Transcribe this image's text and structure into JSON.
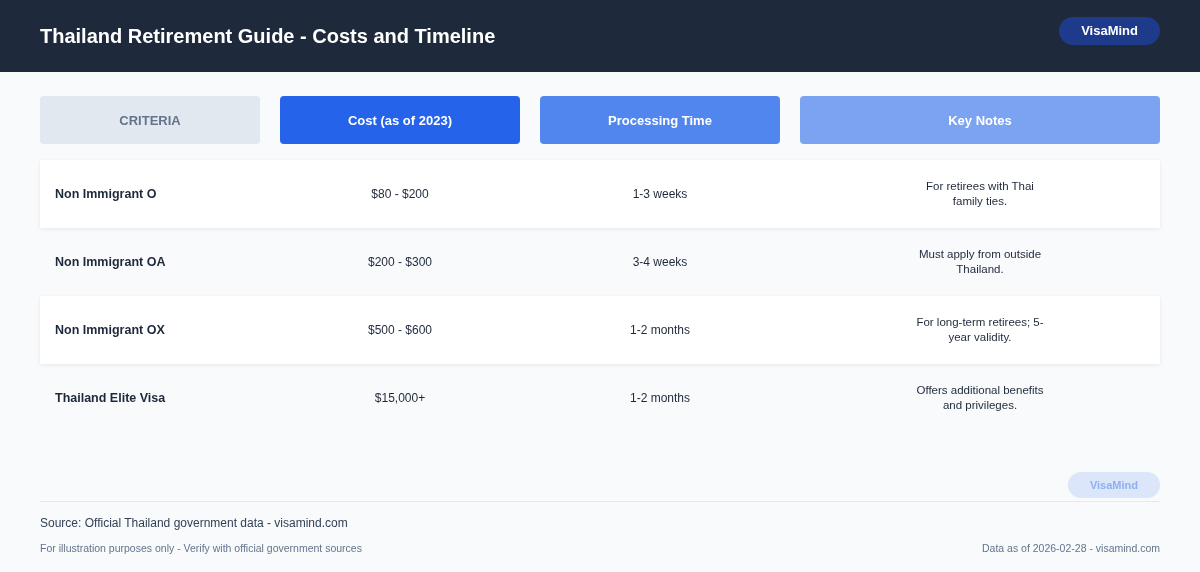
{
  "header": {
    "title": "Thailand Retirement Guide - Costs and Timeline",
    "badge": "VisaMind"
  },
  "table": {
    "columns": [
      {
        "label": "CRITERIA",
        "color": "#e2e8f0"
      },
      {
        "label": "Cost (as of 2023)",
        "color": "#2563eb"
      },
      {
        "label": "Processing Time",
        "color": "#5086ed"
      },
      {
        "label": "Key Notes",
        "color": "#7ca3f1"
      }
    ],
    "rows": [
      {
        "name": "Non Immigrant O",
        "cost": "$80 - $200",
        "time": "1-3 weeks",
        "notes": "For retirees with Thai family ties."
      },
      {
        "name": "Non Immigrant OA",
        "cost": "$200 - $300",
        "time": "3-4 weeks",
        "notes": "Must apply from outside Thailand."
      },
      {
        "name": "Non Immigrant OX",
        "cost": "$500 - $600",
        "time": "1-2 months",
        "notes": "For long-term retirees; 5-year validity."
      },
      {
        "name": "Thailand Elite Visa",
        "cost": "$15,000+",
        "time": "1-2 months",
        "notes": "Offers additional benefits and privileges."
      }
    ]
  },
  "footer": {
    "badge": "VisaMind",
    "source": "Source: Official Thailand government data - visamind.com",
    "disclaimer": "For illustration purposes only - Verify with official government sources",
    "date": "Data as of 2026-02-28 - visamind.com"
  }
}
